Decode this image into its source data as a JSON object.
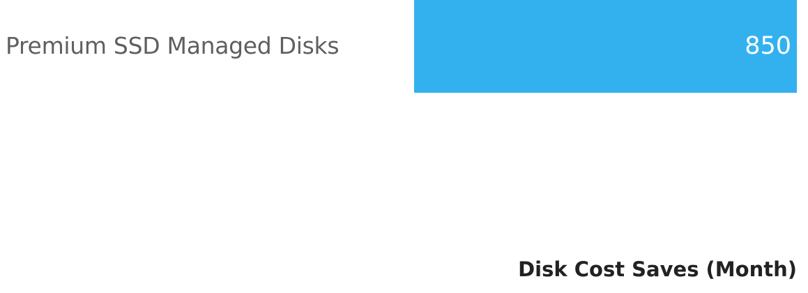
{
  "metric_row": {
    "label": "Premium SSD Managed Disks",
    "value": "850",
    "bar_color": "#33b1ef"
  },
  "section": {
    "title": "Disk Cost Saves (Month)"
  }
}
